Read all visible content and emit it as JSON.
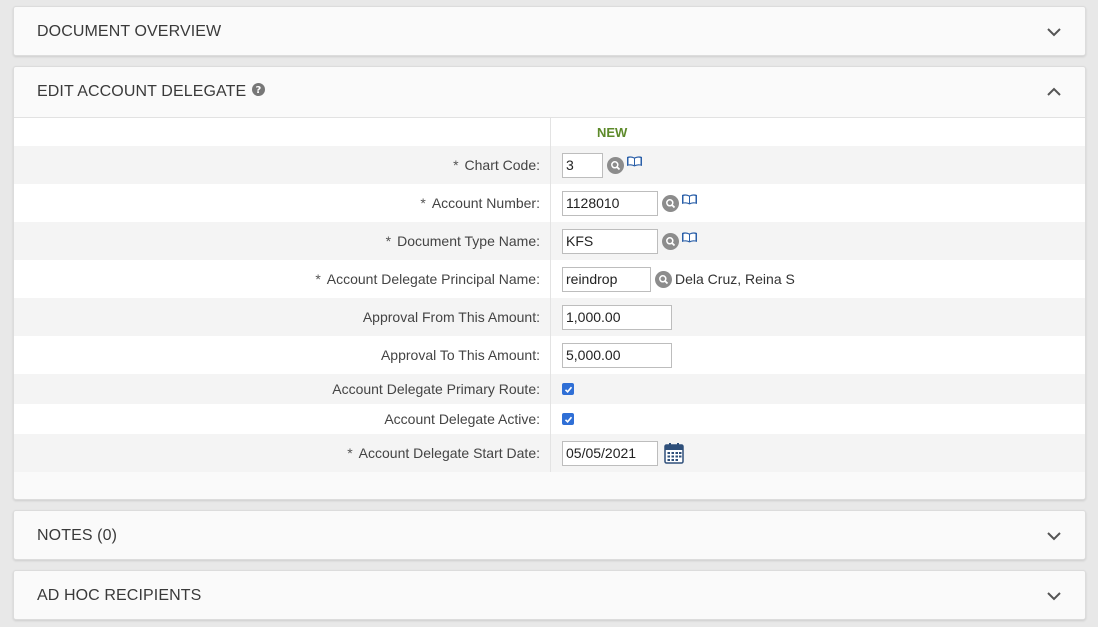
{
  "panels": {
    "overview": "DOCUMENT OVERVIEW",
    "edit": "EDIT ACCOUNT DELEGATE",
    "notes": "NOTES (0)",
    "adhoc": "AD HOC RECIPIENTS"
  },
  "form": {
    "section_label": "NEW",
    "required_mark": "*",
    "chart_code": {
      "label": "Chart Code:",
      "value": "3"
    },
    "account_number": {
      "label": "Account Number:",
      "value": "1128010"
    },
    "document_type": {
      "label": "Document Type Name:",
      "value": "KFS"
    },
    "principal": {
      "label": "Account Delegate Principal Name:",
      "value": "reindrop",
      "name": "Dela Cruz, Reina S"
    },
    "approval_from": {
      "label": "Approval From This Amount:",
      "value": "1,000.00"
    },
    "approval_to": {
      "label": "Approval To This Amount:",
      "value": "5,000.00"
    },
    "primary_route": {
      "label": "Account Delegate Primary Route:",
      "checked": true
    },
    "active": {
      "label": "Account Delegate Active:",
      "checked": true
    },
    "start_date": {
      "label": "Account Delegate Start Date:",
      "value": "05/05/2021"
    }
  },
  "icons": {
    "help": "question-circle-icon",
    "lookup": "magnifier-icon",
    "inquiry": "book-icon",
    "calendar": "calendar-icon",
    "expand": "chevron-down-icon",
    "collapse": "chevron-up-icon"
  },
  "colors": {
    "new_label": "#5d8a2a",
    "checkbox": "#2f6fd6",
    "lookup_icon": "#8c8c8c",
    "book_icon": "#2a5fa8"
  }
}
